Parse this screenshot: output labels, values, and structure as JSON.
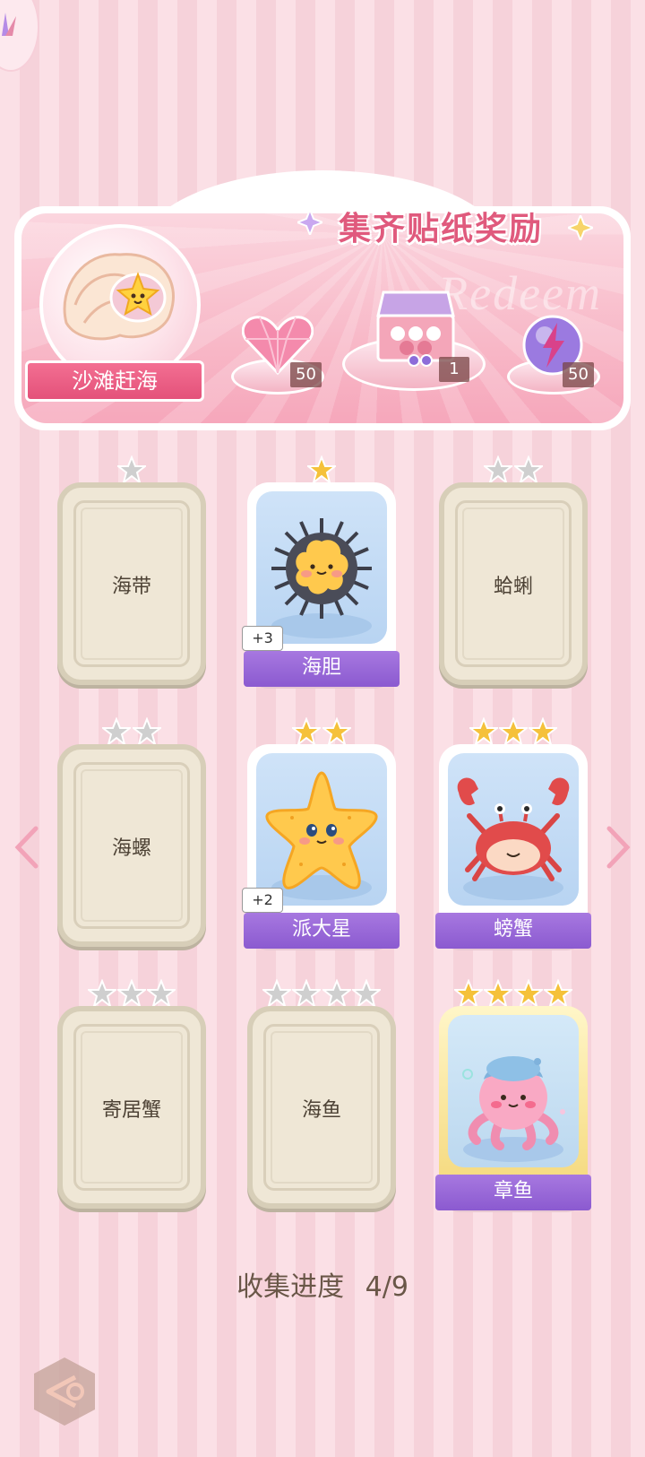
{
  "reward": {
    "title": "集齐贴纸奖励",
    "watermark": "Redeem",
    "album_name": "沙滩赶海",
    "items": [
      {
        "icon": "pink-heart-gem-icon",
        "count": "50"
      },
      {
        "icon": "gift-box-icon",
        "count": "1"
      },
      {
        "icon": "lightning-orb-icon",
        "count": "50"
      }
    ]
  },
  "cards": [
    {
      "name": "海带",
      "stars": 1,
      "owned": false,
      "star_color": "silver"
    },
    {
      "name": "海胆",
      "stars": 1,
      "owned": true,
      "star_color": "gold",
      "plus": "+3",
      "art": "sea-urchin-icon"
    },
    {
      "name": "蛤蜊",
      "stars": 2,
      "owned": false,
      "star_color": "silver"
    },
    {
      "name": "海螺",
      "stars": 2,
      "owned": false,
      "star_color": "silver"
    },
    {
      "name": "派大星",
      "stars": 2,
      "owned": true,
      "star_color": "gold",
      "plus": "+2",
      "art": "starfish-icon"
    },
    {
      "name": "螃蟹",
      "stars": 3,
      "owned": true,
      "star_color": "gold",
      "art": "crab-icon"
    },
    {
      "name": "寄居蟹",
      "stars": 3,
      "owned": false,
      "star_color": "silver"
    },
    {
      "name": "海鱼",
      "stars": 4,
      "owned": false,
      "star_color": "silver"
    },
    {
      "name": "章鱼",
      "stars": 4,
      "owned": true,
      "star_color": "gold",
      "gold_frame": true,
      "art": "octopus-icon"
    }
  ],
  "progress": {
    "label": "收集进度",
    "value": "4/9"
  },
  "colors": {
    "accent": "#e05a7d",
    "nameplate": "#9466d8",
    "gold_star": "#f5c13a",
    "silver_star": "#c8c8c8"
  }
}
